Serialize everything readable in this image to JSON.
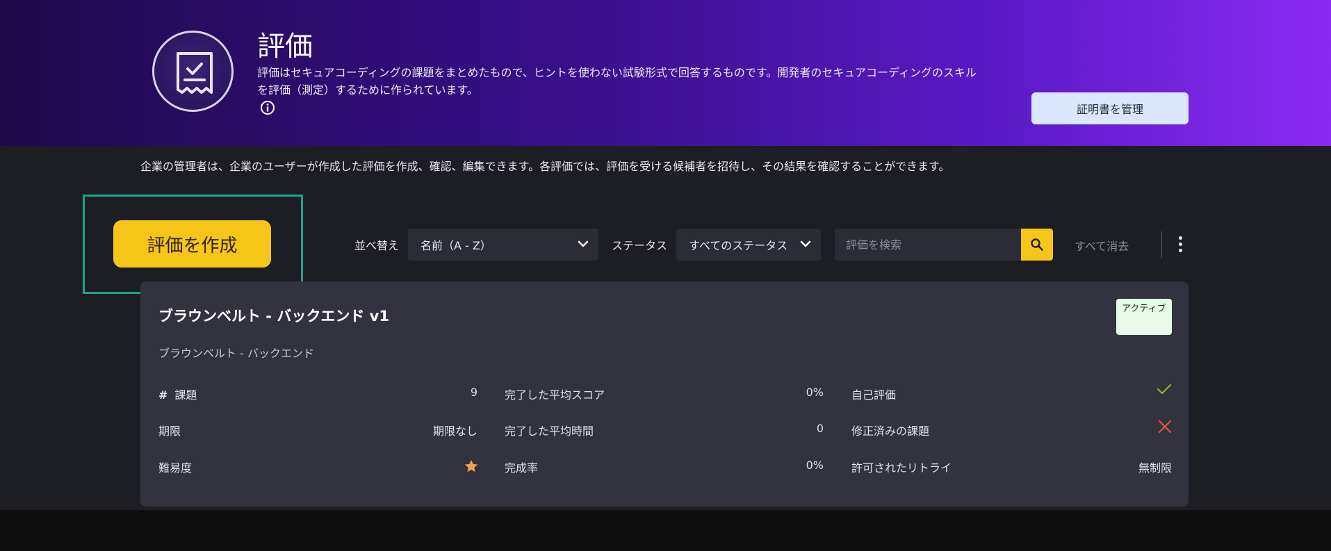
{
  "header": {
    "title": "評価",
    "description": "評価はセキュアコーディングの課題をまとめたもので、ヒントを使わない試験形式で回答するものです。開発者のセキュアコーディングのスキルを評価（測定）するために作られています。",
    "manage_certificates_label": "証明書を管理",
    "icons": [
      "assessment-badge-icon",
      "info-icon"
    ]
  },
  "admin_note": "企業の管理者は、企業のユーザーが作成した評価を作成、確認、編集できます。各評価では、評価を受ける候補者を招待し、その結果を確認することができます。",
  "toolbar": {
    "create_label": "評価を作成",
    "sort_label": "並べ替え",
    "sort_value": "名前（A - Z）",
    "status_label": "ステータス",
    "status_value": "すべてのステータス",
    "search_placeholder": "評価を検索",
    "clear_all_label": "すべて消去"
  },
  "card": {
    "title": "ブラウンベルト - バックエンド v1",
    "subtitle": "ブラウンベルト - バックエンド",
    "status_badge": "アクティブ",
    "col1": [
      {
        "label": "課題",
        "value": "9",
        "prefix": "#"
      },
      {
        "label": "期限",
        "value": "期限なし"
      },
      {
        "label": "難易度",
        "value": "",
        "icon": "star-icon"
      }
    ],
    "col2": [
      {
        "label": "完了した平均スコア",
        "value": "0%"
      },
      {
        "label": "完了した平均時間",
        "value": "0"
      },
      {
        "label": "完成率",
        "value": "0%"
      }
    ],
    "col3": [
      {
        "label": "自己評価",
        "value": "",
        "icon": "check-icon"
      },
      {
        "label": "修正済みの課題",
        "value": "",
        "icon": "cross-icon"
      },
      {
        "label": "許可されたリトライ",
        "value": "無制限"
      }
    ],
    "colors": {
      "check": "#8fb33a",
      "cross": "#e0533f",
      "star": "#f2a444"
    }
  }
}
